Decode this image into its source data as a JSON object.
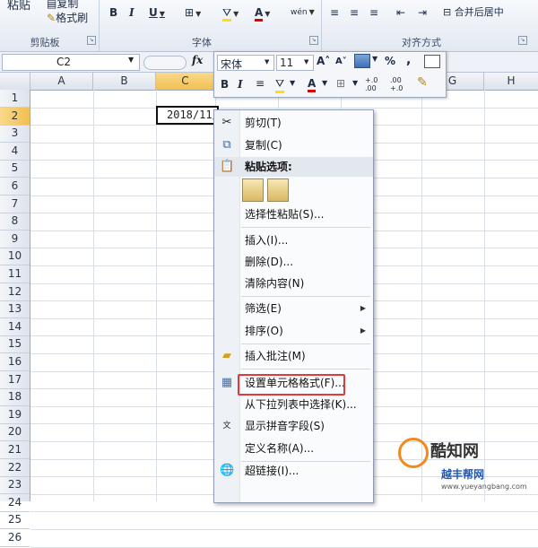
{
  "ribbon": {
    "clipboard": {
      "paste_label": "粘贴",
      "copy_label": "复制",
      "format_painter_label": "格式刷",
      "group_label": "剪贴板"
    },
    "font": {
      "bold": "B",
      "italic": "I",
      "underline": "U",
      "group_label": "字体",
      "font_color_glyph": "A",
      "wen_glyph": "wén"
    },
    "alignment": {
      "merge_center_label": "合并后居中",
      "group_label": "对齐方式"
    }
  },
  "formula_bar": {
    "name_box": "C2",
    "fx": "fx"
  },
  "columns": [
    "A",
    "B",
    "C",
    "D",
    "E",
    "F",
    "G",
    "H"
  ],
  "rows": [
    "1",
    "2",
    "3",
    "4",
    "5",
    "6",
    "7",
    "8",
    "9",
    "10",
    "11",
    "12",
    "13",
    "14",
    "15",
    "16",
    "17",
    "18",
    "19",
    "20",
    "21",
    "22",
    "23",
    "24",
    "25",
    "26"
  ],
  "active_cell": {
    "value": "2018/11/"
  },
  "mini_toolbar": {
    "font_name": "宋体",
    "font_size": "11",
    "grow_font": "A˄",
    "shrink_font": "A˅",
    "percent": "%",
    "comma": ",",
    "bold": "B",
    "italic": "I",
    "font_color_glyph": "A",
    "inc_decimal": "+.0 .00",
    "dec_decimal": ".00 +.0"
  },
  "context_menu": {
    "items": [
      {
        "label": "剪切(T)",
        "icon": "scissors-icon"
      },
      {
        "label": "复制(C)",
        "icon": "copy-icon"
      },
      {
        "label": "粘贴选项:",
        "icon": "paste-icon"
      },
      {
        "label": "选择性粘贴(S)...",
        "icon": ""
      },
      {
        "label": "插入(I)...",
        "icon": ""
      },
      {
        "label": "删除(D)...",
        "icon": ""
      },
      {
        "label": "清除内容(N)",
        "icon": ""
      },
      {
        "label": "筛选(E)",
        "icon": ""
      },
      {
        "label": "排序(O)",
        "icon": ""
      },
      {
        "label": "插入批注(M)",
        "icon": "comment-icon"
      },
      {
        "label": "设置单元格格式(F)...",
        "icon": "format-cells-icon"
      },
      {
        "label": "从下拉列表中选择(K)...",
        "icon": ""
      },
      {
        "label": "显示拼音字段(S)",
        "icon": "pinyin-icon"
      },
      {
        "label": "定义名称(A)...",
        "icon": ""
      },
      {
        "label": "超链接(I)...",
        "icon": "hyperlink-icon"
      }
    ],
    "highlight_color": "#e03a3a"
  },
  "watermark": {
    "brand": "酷知网",
    "url": "www.yueyangbang.com",
    "sub": "越丰帮网"
  }
}
